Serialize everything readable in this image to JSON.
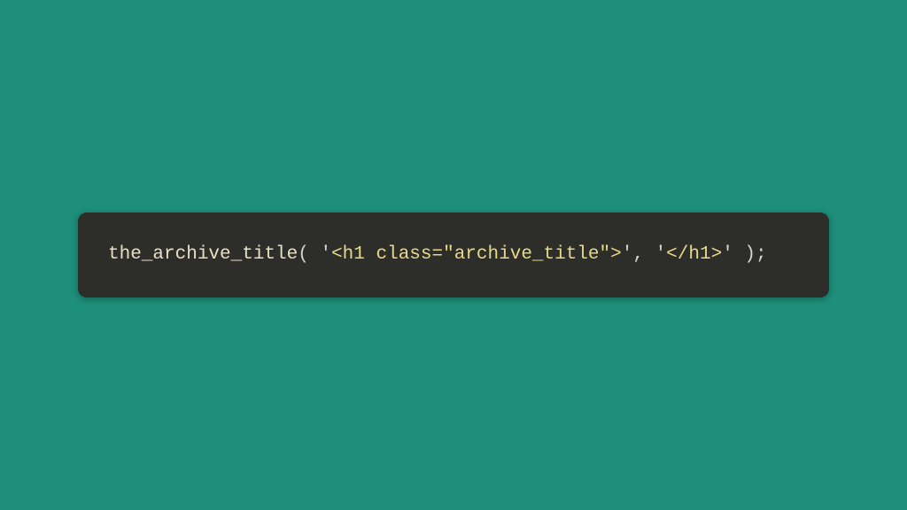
{
  "code": {
    "function_name": "the_archive_title",
    "open_paren": "( ",
    "string1_open": "'",
    "string1_content": "<h1 class=\"archive_title\">",
    "string1_close": "'",
    "separator": ", ",
    "string2_open": "'",
    "string2_content": "</h1>",
    "string2_close": "'",
    "close_paren": " )",
    "terminator": ";"
  },
  "colors": {
    "background": "#1e8f7a",
    "code_bg": "#2d2d2a",
    "function": "#e8e0c5",
    "string": "#e8d98a",
    "default": "#d4d4d4"
  }
}
